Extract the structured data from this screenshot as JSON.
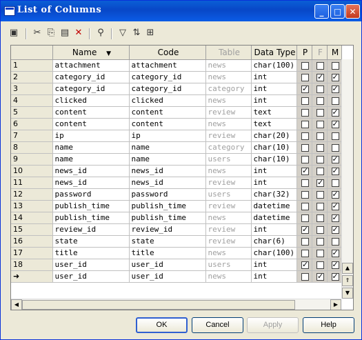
{
  "window": {
    "title": "List of Columns"
  },
  "toolbar": {
    "tools": [
      {
        "name": "properties-icon",
        "glyph": "▣"
      },
      {
        "name": "cut-icon",
        "glyph": "✂"
      },
      {
        "name": "copy-icon",
        "glyph": "⎘"
      },
      {
        "name": "paste-icon",
        "glyph": "📋"
      },
      {
        "name": "delete-icon",
        "glyph": "✕"
      },
      {
        "name": "find-icon",
        "glyph": "🔍"
      },
      {
        "name": "filter-icon",
        "glyph": "▽"
      },
      {
        "name": "sort-icon",
        "glyph": "⇅"
      },
      {
        "name": "tree-icon",
        "glyph": "⊞"
      }
    ]
  },
  "grid": {
    "columns": {
      "name": "Name",
      "code": "Code",
      "table": "Table",
      "datatype": "Data Type",
      "p": "P",
      "f": "F",
      "m": "M"
    },
    "rows": [
      {
        "num": "1",
        "name": "attachment",
        "code": "attachment",
        "table": "news",
        "type": "char(100)",
        "p": false,
        "f": false,
        "m": false
      },
      {
        "num": "2",
        "name": "category_id",
        "code": "category_id",
        "table": "news",
        "type": "int",
        "p": false,
        "f": true,
        "m": true
      },
      {
        "num": "3",
        "name": "category_id",
        "code": "category_id",
        "table": "category",
        "type": "int",
        "p": true,
        "f": false,
        "m": true
      },
      {
        "num": "4",
        "name": "clicked",
        "code": "clicked",
        "table": "news",
        "type": "int",
        "p": false,
        "f": false,
        "m": false
      },
      {
        "num": "5",
        "name": "content",
        "code": "content",
        "table": "review",
        "type": "text",
        "p": false,
        "f": false,
        "m": true
      },
      {
        "num": "6",
        "name": "content",
        "code": "content",
        "table": "news",
        "type": "text",
        "p": false,
        "f": false,
        "m": true
      },
      {
        "num": "7",
        "name": "ip",
        "code": "ip",
        "table": "review",
        "type": "char(20)",
        "p": false,
        "f": false,
        "m": false
      },
      {
        "num": "8",
        "name": "name",
        "code": "name",
        "table": "category",
        "type": "char(10)",
        "p": false,
        "f": false,
        "m": false
      },
      {
        "num": "9",
        "name": "name",
        "code": "name",
        "table": "users",
        "type": "char(10)",
        "p": false,
        "f": false,
        "m": true
      },
      {
        "num": "10",
        "name": "news_id",
        "code": "news_id",
        "table": "news",
        "type": "int",
        "p": true,
        "f": false,
        "m": true
      },
      {
        "num": "11",
        "name": "news_id",
        "code": "news_id",
        "table": "review",
        "type": "int",
        "p": false,
        "f": true,
        "m": false
      },
      {
        "num": "12",
        "name": "password",
        "code": "password",
        "table": "users",
        "type": "char(32)",
        "p": false,
        "f": false,
        "m": true
      },
      {
        "num": "13",
        "name": "publish_time",
        "code": "publish_time",
        "table": "review",
        "type": "datetime",
        "p": false,
        "f": false,
        "m": true
      },
      {
        "num": "14",
        "name": "publish_time",
        "code": "publish_time",
        "table": "news",
        "type": "datetime",
        "p": false,
        "f": false,
        "m": true
      },
      {
        "num": "15",
        "name": "review_id",
        "code": "review_id",
        "table": "review",
        "type": "int",
        "p": true,
        "f": false,
        "m": true
      },
      {
        "num": "16",
        "name": "state",
        "code": "state",
        "table": "review",
        "type": "char(6)",
        "p": false,
        "f": false,
        "m": false
      },
      {
        "num": "17",
        "name": "title",
        "code": "title",
        "table": "news",
        "type": "char(100)",
        "p": false,
        "f": false,
        "m": true
      },
      {
        "num": "18",
        "name": "user_id",
        "code": "user_id",
        "table": "users",
        "type": "int",
        "p": true,
        "f": false,
        "m": true
      },
      {
        "num": "➜",
        "name": "user_id",
        "code": "user_id",
        "table": "news",
        "type": "int",
        "p": false,
        "f": true,
        "m": true
      }
    ]
  },
  "buttons": {
    "ok": "OK",
    "cancel": "Cancel",
    "apply": "Apply",
    "help": "Help"
  }
}
